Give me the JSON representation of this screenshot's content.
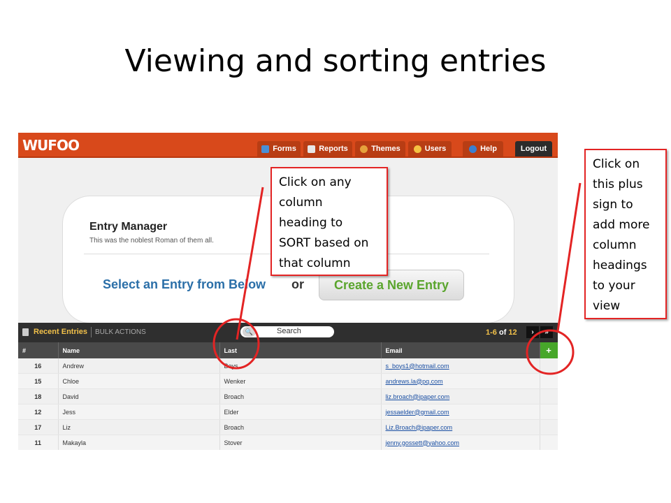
{
  "slide_title": "Viewing and sorting entries",
  "app": {
    "logo": "WUFOO",
    "nav": [
      {
        "label": "Forms",
        "icon": "forms-icon",
        "color": "#4a8fd6"
      },
      {
        "label": "Reports",
        "icon": "reports-icon",
        "color": "#e7e7e7"
      },
      {
        "label": "Themes",
        "icon": "themes-icon",
        "color": "#e6a23c"
      },
      {
        "label": "Users",
        "icon": "users-icon",
        "color": "#f5c242"
      },
      {
        "label": "Help",
        "icon": "help-icon",
        "color": "#3b7fd0"
      }
    ],
    "logout_label": "Logout",
    "entry_manager": {
      "title": "Entry Manager",
      "subtitle": "This was the noblest Roman of them all.",
      "select_text": "Select an Entry from Below",
      "or_text": "or",
      "create_label": "Create a New Entry"
    },
    "toolbar": {
      "recent_label": "Recent Entries",
      "bulk_label": "BULK ACTIONS",
      "search_placeholder": "Search",
      "pager_range": "1-6",
      "pager_of": "of",
      "pager_total": "12",
      "next_label": "›",
      "last_label": "»"
    },
    "table": {
      "headers": [
        "#",
        "Name",
        "Last",
        "Email"
      ],
      "add_column_label": "+",
      "rows": [
        {
          "num": "16",
          "name": "Andrew",
          "last": "Boys",
          "email": "s_boys1@hotmail.com"
        },
        {
          "num": "15",
          "name": "Chloe",
          "last": "Wenker",
          "email": "andrews.la@pq.com"
        },
        {
          "num": "18",
          "name": "David",
          "last": "Broach",
          "email": "liz.broach@ipaper.com"
        },
        {
          "num": "12",
          "name": "Jess",
          "last": "Elder",
          "email": "jessaelder@gmail.com"
        },
        {
          "num": "17",
          "name": "Liz",
          "last": "Broach",
          "email": "Liz.Broach@ipaper.com"
        },
        {
          "num": "11",
          "name": "Makayla",
          "last": "Stover",
          "email": "jenny.gossett@yahoo.com"
        }
      ]
    }
  },
  "callouts": {
    "sort_lines": [
      "Click on any",
      "column",
      "heading to",
      "SORT based on",
      "that column"
    ],
    "plus_lines": [
      "Click on",
      "this plus",
      "sign to",
      "add more",
      "column",
      "headings",
      "to your",
      "view"
    ]
  },
  "colors": {
    "brand_orange": "#d8491b",
    "annotation_red": "#e32424",
    "add_green": "#47a72a"
  }
}
